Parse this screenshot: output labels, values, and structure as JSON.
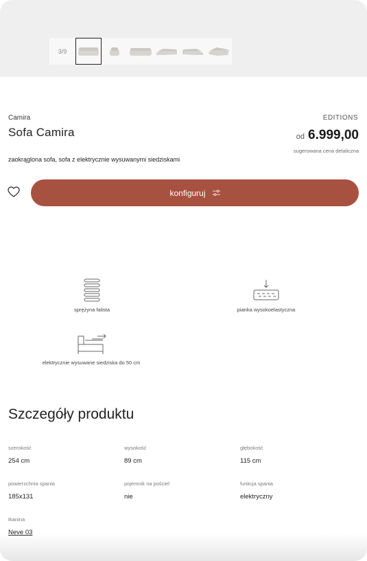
{
  "gallery": {
    "counter": "3/9",
    "thumbnails": [
      "sofa-thumbnail-1",
      "sofa-thumbnail-2",
      "sofa-thumbnail-3",
      "sofa-thumbnail-4",
      "sofa-thumbnail-5",
      "sofa-thumbnail-6"
    ],
    "active_index": 0
  },
  "product": {
    "brand": "Camira",
    "name": "Sofa Camira",
    "collection": "EDITIONS",
    "price_prefix": "od",
    "price": "6.999,00",
    "price_note": "sugerowana cena detaliczna",
    "description": "zaokrąglona sofa, sofa z elektrycznie wysuwanymi siedziskami"
  },
  "actions": {
    "wishlist_icon": "heart-icon",
    "configure_label": "konfiguruj",
    "configure_icon": "sliders-icon",
    "accent_color": "#a75141"
  },
  "features": [
    {
      "icon": "spring-icon",
      "label": "sprężyna falista"
    },
    {
      "icon": "foam-icon",
      "label": "pianka wysokoelastyczna"
    },
    {
      "icon": "extending-seat-icon",
      "label": "elektrycznie wysuwane siedziska do 50 cm"
    }
  ],
  "details": {
    "title": "Szczegóły produktu",
    "specs": [
      {
        "label": "szerokość",
        "value": "254 cm"
      },
      {
        "label": "wysokość",
        "value": "89 cm"
      },
      {
        "label": "głębokość",
        "value": "115 cm"
      },
      {
        "label": "powierzchnia spania",
        "value": "185x131"
      },
      {
        "label": "pojemnik na pościel",
        "value": "nie"
      },
      {
        "label": "funkcja spania",
        "value": "elektryczny"
      },
      {
        "label": "tkanina",
        "value": "Neve 03"
      }
    ]
  }
}
